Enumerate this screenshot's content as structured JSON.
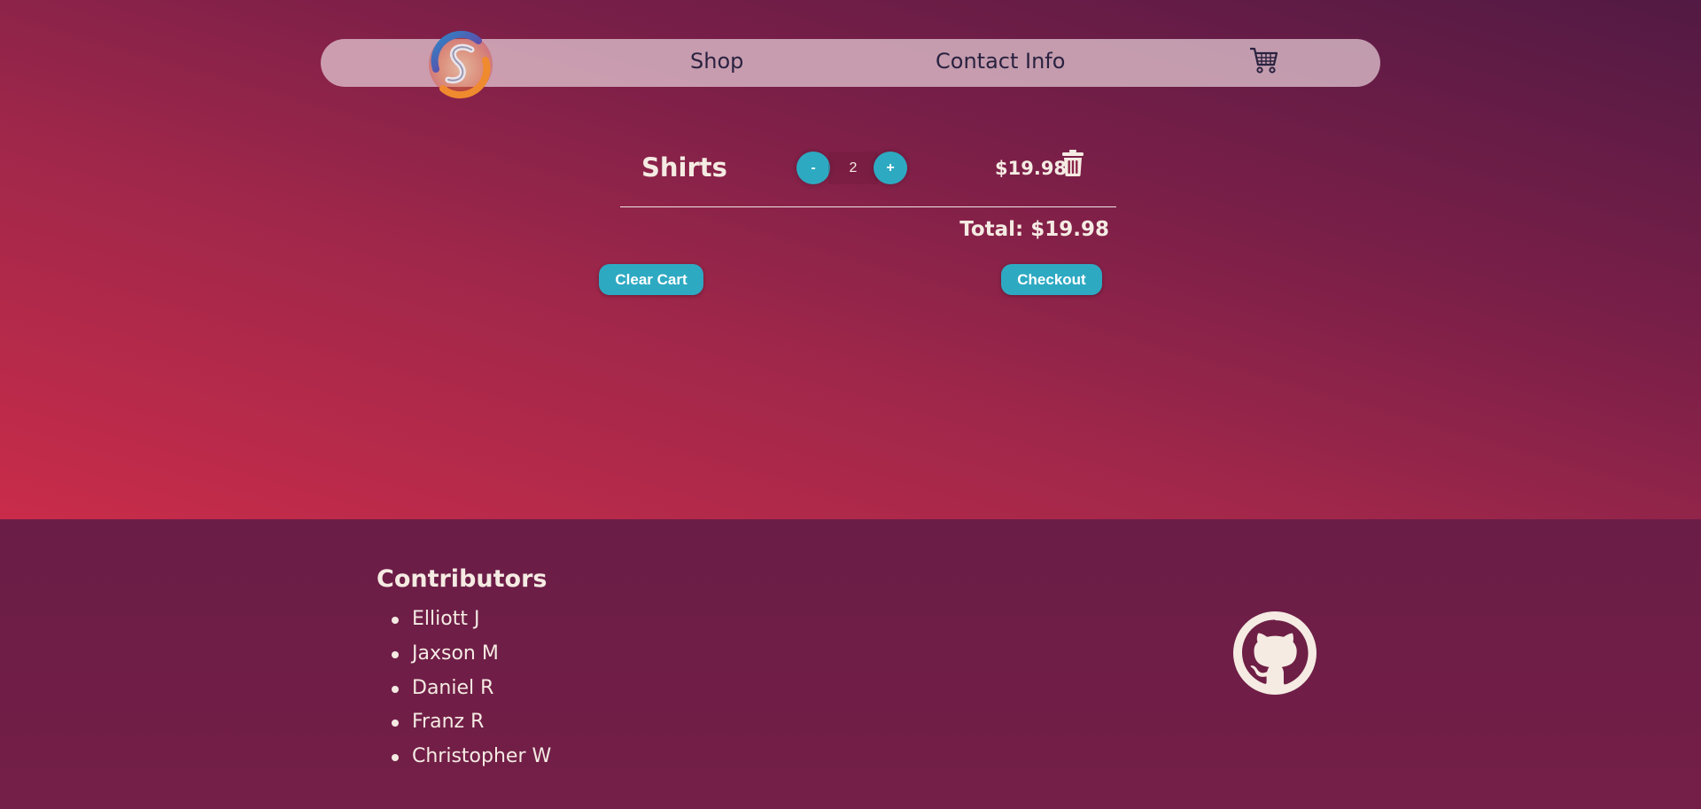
{
  "nav": {
    "logo_alt": "S logo",
    "links": [
      {
        "label": "Shop"
      },
      {
        "label": "Contact Info"
      }
    ],
    "cart_icon": "shopping-cart-icon"
  },
  "cart": {
    "items": [
      {
        "name": "Shirts",
        "quantity": "2",
        "price": "$19.98",
        "minus_label": "-",
        "plus_label": "+"
      }
    ],
    "total": "Total: $19.98",
    "clear_label": "Clear Cart",
    "checkout_label": "Checkout"
  },
  "footer": {
    "contributors_title": "Contributors",
    "contributors": [
      "Elliott J",
      "Jaxson M",
      "Daniel R",
      "Franz R",
      "Christopher W"
    ],
    "github_icon": "github-icon"
  },
  "colors": {
    "accent": "#2ea9c2",
    "text_light": "#f5ebe3",
    "nav_text": "#2a2240"
  }
}
